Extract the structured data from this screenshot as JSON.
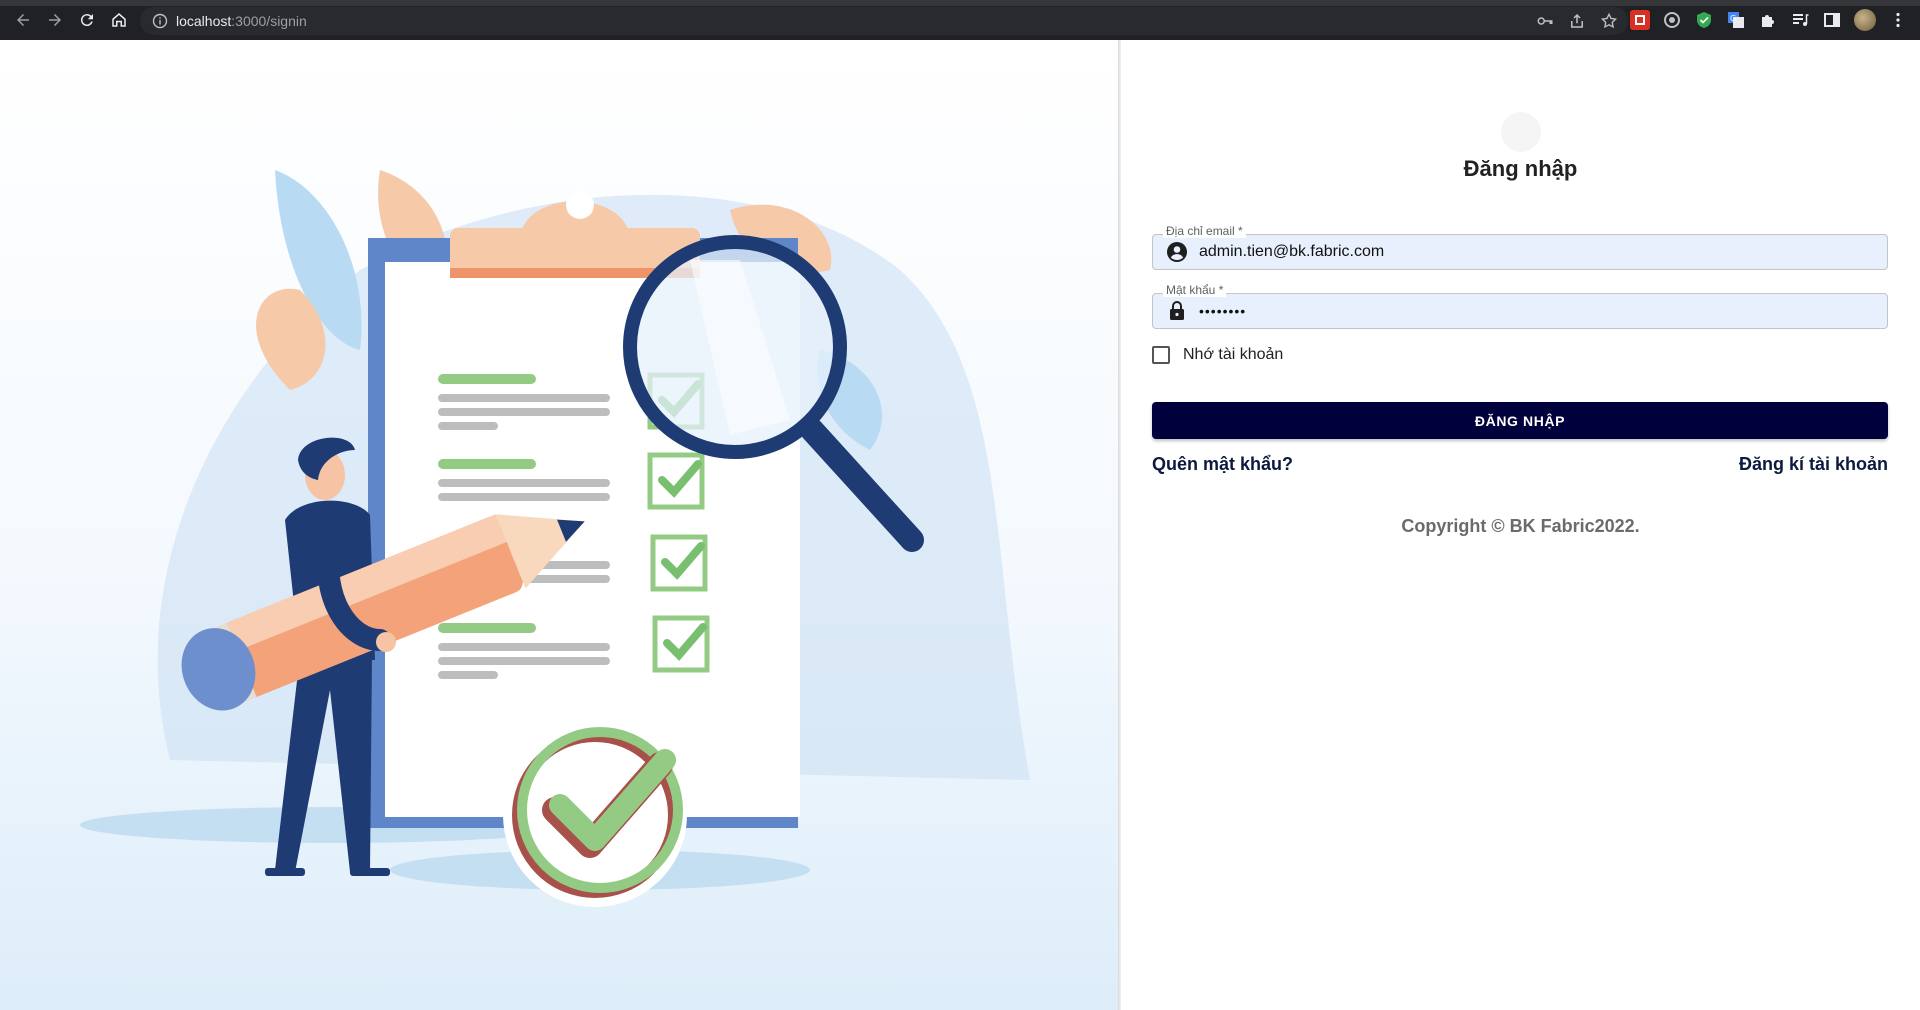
{
  "browser": {
    "url_host": "localhost",
    "url_path": ":3000/signin"
  },
  "signin": {
    "title": "Đăng nhập",
    "email_label": "Địa chỉ email *",
    "email_value": "admin.tien@bk.fabric.com",
    "password_label": "Mật khẩu *",
    "password_value": "••••••••",
    "remember_label": "Nhớ tài khoản",
    "submit_label": "ĐĂNG NHẬP",
    "forgot_label": "Quên mật khẩu?",
    "register_label": "Đăng kí tài khoản",
    "copyright": "Copyright © BK Fabric2022."
  },
  "colors": {
    "primary": "#00003d",
    "input_bg": "#e8f0fe",
    "link": "#0b1a3e"
  },
  "icons": {
    "email_icon": "account-circle-icon",
    "password_icon": "lock-icon"
  }
}
